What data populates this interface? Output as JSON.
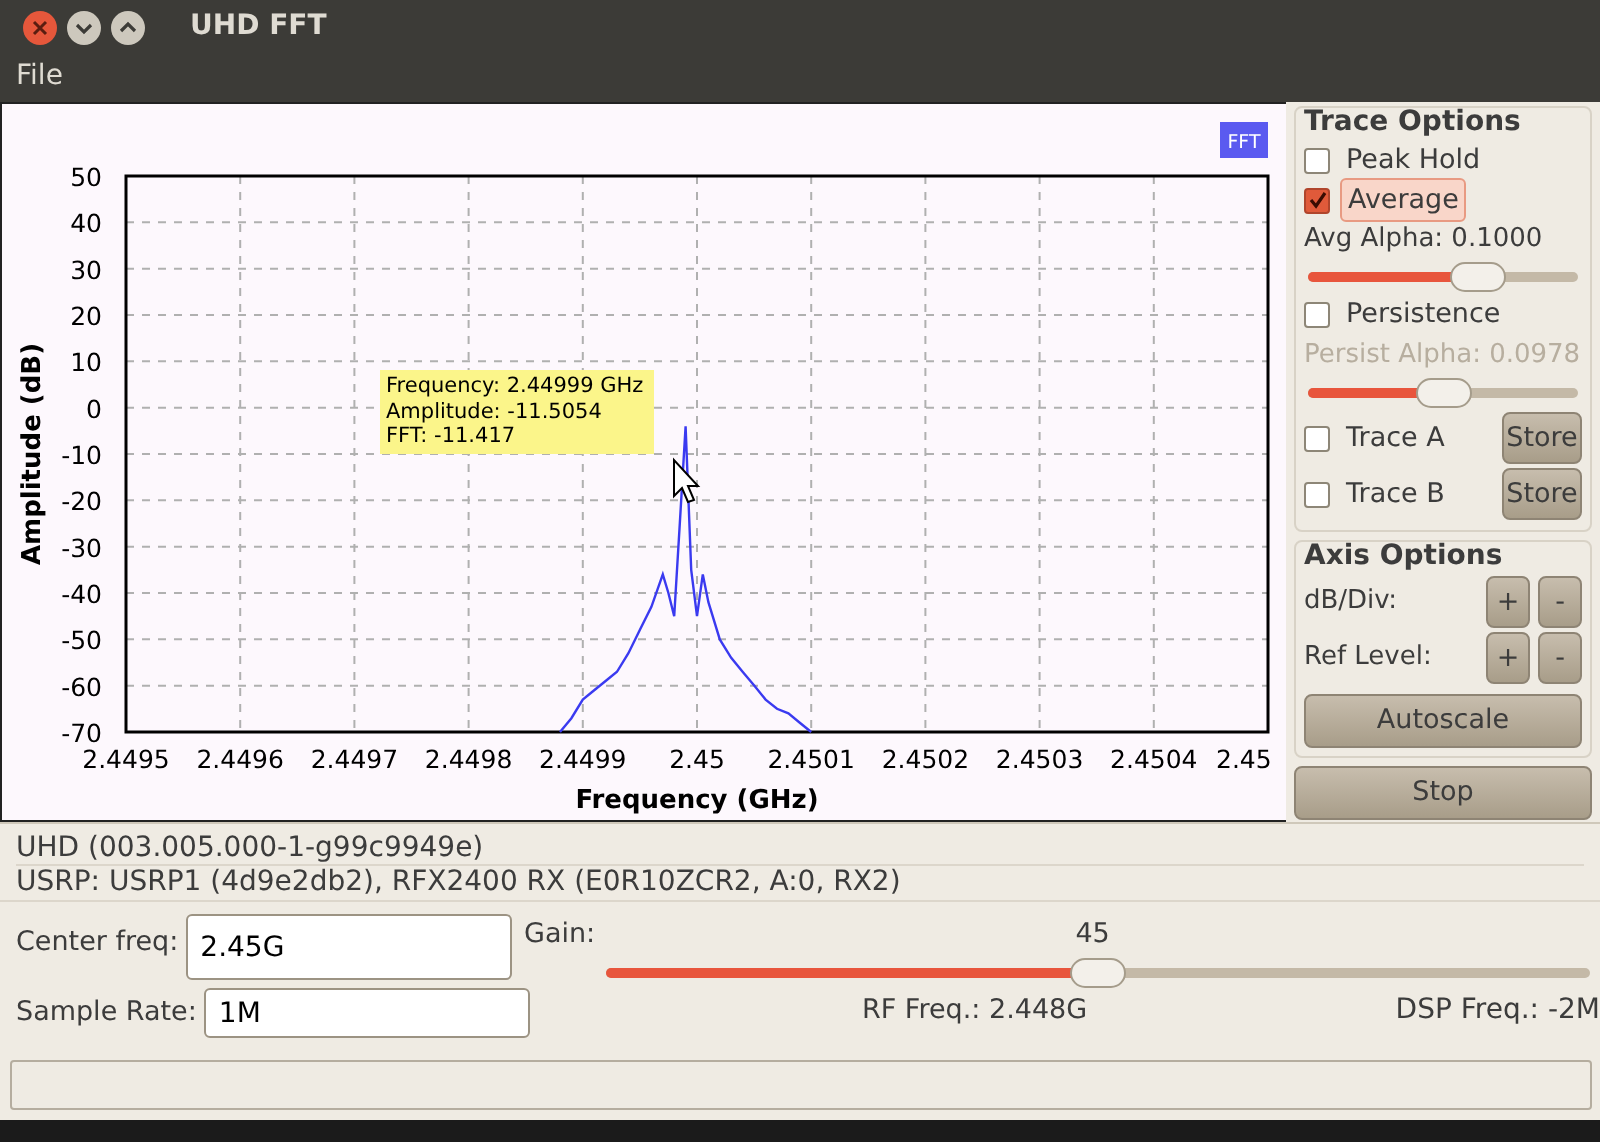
{
  "window": {
    "title": "UHD FFT"
  },
  "menu": [
    "File"
  ],
  "plot": {
    "tooltip": [
      "Frequency: 2.44999 GHz",
      "Amplitude: -11.5054",
      "FFT: -11.417"
    ],
    "chart_data": {
      "type": "line",
      "grid": true,
      "xlabel": "Frequency (GHz)",
      "ylabel": "Amplitude (dB)",
      "x": [
        2.44988,
        2.44989,
        2.4499,
        2.44991,
        2.44992,
        2.44993,
        2.44994,
        2.44995,
        2.44996,
        2.44997,
        2.449975,
        2.44998,
        2.449985,
        2.44999,
        2.449995,
        2.45,
        2.450005,
        2.45001,
        2.45002,
        2.45003,
        2.45004,
        2.45005,
        2.45006,
        2.45007,
        2.45008,
        2.45009,
        2.4501
      ],
      "series": [
        {
          "name": "FFT",
          "color": "#3a3af0",
          "values": [
            -70,
            -67,
            -63,
            -61,
            -59,
            -57,
            -53,
            -48,
            -43,
            -36,
            -40,
            -45,
            -25,
            -4,
            -35,
            -45,
            -36,
            -42,
            -50,
            -54,
            -57,
            -60,
            -63,
            -65,
            -66,
            -68,
            -70
          ]
        }
      ],
      "xlim": [
        2.4495,
        2.4505
      ],
      "ylim": [
        -70,
        50
      ],
      "xticks": [
        {
          "value": 2.4495,
          "label": "2.4495"
        },
        {
          "value": 2.4496,
          "label": "2.4496"
        },
        {
          "value": 2.4497,
          "label": "2.4497"
        },
        {
          "value": 2.4498,
          "label": "2.4498"
        },
        {
          "value": 2.4499,
          "label": "2.4499"
        },
        {
          "value": 2.45,
          "label": "2.45"
        },
        {
          "value": 2.4501,
          "label": "2.4501"
        },
        {
          "value": 2.4502,
          "label": "2.4502"
        },
        {
          "value": 2.4503,
          "label": "2.4503"
        },
        {
          "value": 2.4504,
          "label": "2.4504"
        },
        {
          "value": 2.4505,
          "label": "2.45"
        }
      ],
      "yticks": [
        50,
        40,
        30,
        20,
        10,
        0,
        -10,
        -20,
        -30,
        -40,
        -50,
        -60,
        -70
      ]
    }
  },
  "trace_options": {
    "title": "Trace Options",
    "items": [
      {
        "kind": "check",
        "label": "Peak Hold",
        "checked": false
      },
      {
        "kind": "check",
        "label": "Average",
        "checked": true
      },
      {
        "kind": "slider",
        "label": "Avg Alpha: 0.1000",
        "level": 0.63,
        "disabled": false
      },
      {
        "kind": "check",
        "label": "Persistence",
        "checked": false
      },
      {
        "kind": "slider",
        "label": "Persist Alpha: 0.0978",
        "level": 0.5,
        "disabled": true
      },
      {
        "kind": "store",
        "label": "Trace A",
        "checked": false,
        "button": "Store"
      },
      {
        "kind": "store",
        "label": "Trace B",
        "checked": false,
        "button": "Store"
      }
    ]
  },
  "axis_options": {
    "title": "Axis Options",
    "rows": [
      {
        "label": "dB/Div:",
        "buttons": [
          "+",
          "-"
        ]
      },
      {
        "label": "Ref Level:",
        "buttons": [
          "+",
          "-"
        ]
      }
    ],
    "autoscale": "Autoscale"
  },
  "stop_button": "Stop",
  "info": [
    "UHD (003.005.000-1-g99c9949e)",
    "USRP: USRP1 (4d9e2db2), RFX2400 RX (E0R10ZCR2, A:0, RX2)"
  ],
  "controls": {
    "center_freq": {
      "label": "Center freq:",
      "value": "2.45G"
    },
    "sample_rate": {
      "label": "Sample Rate:",
      "value": "1M"
    },
    "gain": {
      "label": "Gain:",
      "value": "45",
      "level": 0.5
    },
    "rf_freq": "RF Freq.: 2.448G",
    "dsp_freq": "DSP Freq.: -2M"
  }
}
